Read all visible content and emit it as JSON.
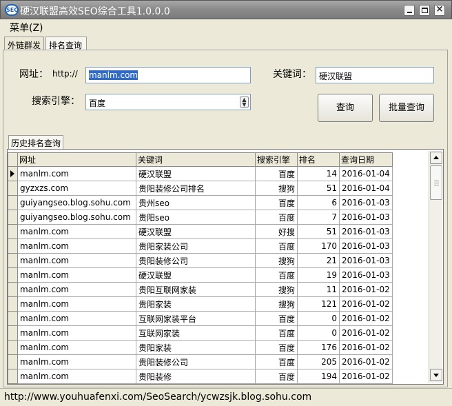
{
  "window": {
    "icon_text": "SEO",
    "title": "硬汉联盟高效SEO综合工具1.0.0.0"
  },
  "menu": {
    "label": "菜单(Z)"
  },
  "tabs": [
    "外链群发",
    "排名查询"
  ],
  "query": {
    "url_label": "网址：",
    "url_prefix": "http://",
    "url_value": "manlm.com",
    "keyword_label": "关键词：",
    "keyword_value": "硬汉联盟",
    "engine_label": "搜索引擎：",
    "engine_value": "百度",
    "query_button": "查询",
    "batch_button": "批量查询"
  },
  "history": {
    "tab_label": "历史排名查询",
    "columns": [
      "网址",
      "关键词",
      "搜索引擎",
      "排名",
      "查询日期"
    ],
    "rows": [
      [
        "manlm.com",
        "硬汉联盟",
        "百度",
        "14",
        "2016-01-04"
      ],
      [
        "gyzxzs.com",
        "贵阳装修公司排名",
        "搜狗",
        "51",
        "2016-01-04"
      ],
      [
        "guiyangseo.blog.sohu.com",
        "贵州seo",
        "百度",
        "6",
        "2016-01-03"
      ],
      [
        "guiyangseo.blog.sohu.com",
        "贵阳seo",
        "百度",
        "7",
        "2016-01-03"
      ],
      [
        "manlm.com",
        "硬汉联盟",
        "好搜",
        "51",
        "2016-01-03"
      ],
      [
        "manlm.com",
        "贵阳家装公司",
        "百度",
        "170",
        "2016-01-03"
      ],
      [
        "manlm.com",
        "贵阳装修公司",
        "搜狗",
        "21",
        "2016-01-03"
      ],
      [
        "manlm.com",
        "硬汉联盟",
        "百度",
        "19",
        "2016-01-03"
      ],
      [
        "manlm.com",
        "贵阳互联网家装",
        "搜狗",
        "11",
        "2016-01-02"
      ],
      [
        "manlm.com",
        "贵阳家装",
        "搜狗",
        "121",
        "2016-01-02"
      ],
      [
        "manlm.com",
        "互联网家装平台",
        "百度",
        "0",
        "2016-01-02"
      ],
      [
        "manlm.com",
        "互联网家装",
        "百度",
        "0",
        "2016-01-02"
      ],
      [
        "manlm.com",
        "贵阳家装",
        "百度",
        "176",
        "2016-01-02"
      ],
      [
        "manlm.com",
        "贵阳装修公司",
        "百度",
        "205",
        "2016-01-02"
      ],
      [
        "manlm.com",
        "贵阳装修",
        "百度",
        "194",
        "2016-01-02"
      ]
    ]
  },
  "status": {
    "text": "http://www.youhuafenxi.com/SeoSearch/ycwzsjk.blog.sohu.com"
  }
}
